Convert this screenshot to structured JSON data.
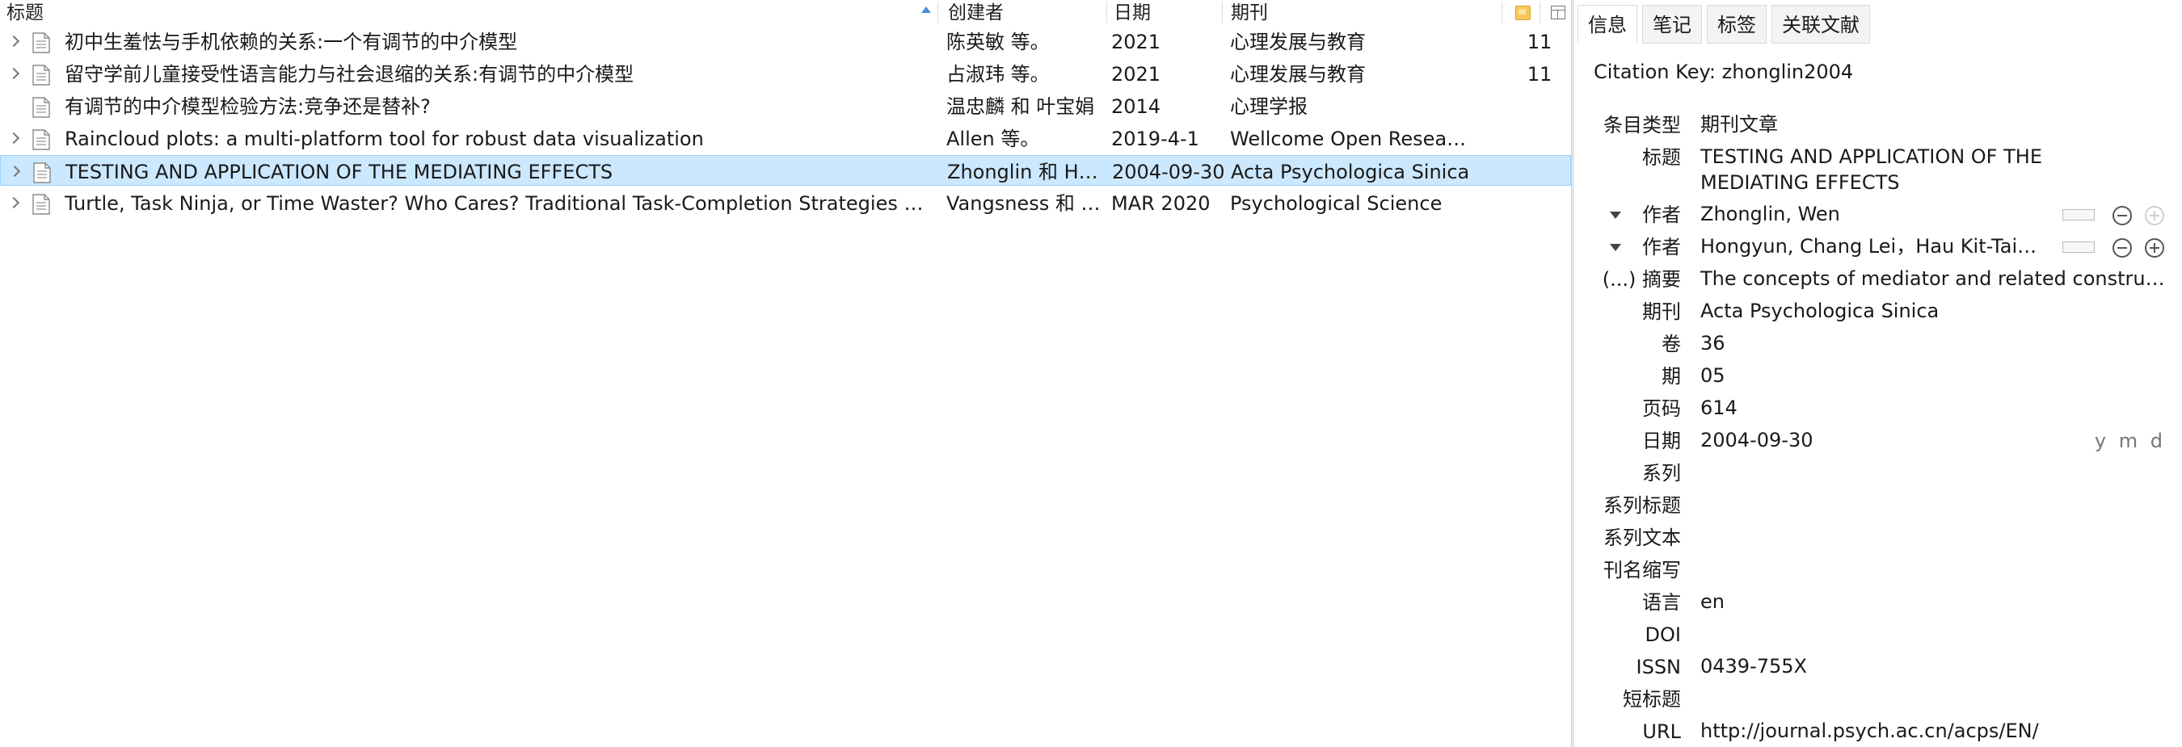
{
  "columns": {
    "title": "标题",
    "creator": "创建者",
    "date": "日期",
    "publication": "期刊"
  },
  "items": [
    {
      "title": "初中生羞怯与手机依赖的关系:一个有调节的中介模型",
      "creator": "陈英敏 等。",
      "date": "2021",
      "publication": "心理发展与教育",
      "extra": "11"
    },
    {
      "title": "留守学前儿童接受性语言能力与社会退缩的关系:有调节的中介模型",
      "creator": "占淑玮 等。",
      "date": "2021",
      "publication": "心理发展与教育",
      "extra": "11"
    },
    {
      "title": "有调节的中介模型检验方法:竞争还是替补?",
      "creator": "温忠麟 和 叶宝娟",
      "date": "2014",
      "publication": "心理学报",
      "extra": ""
    },
    {
      "title": "Raincloud plots: a multi-platform tool for robust data visualization",
      "creator": "Allen 等。",
      "date": "2019-4-1",
      "publication": "Wellcome Open Research",
      "extra": ""
    },
    {
      "title": "TESTING AND APPLICATION OF THE MEDIATING EFFECTS",
      "creator": "Zhonglin 和 Hongyun",
      "date": "2004-09-30",
      "publication": "Acta Psychologica Sinica",
      "extra": ""
    },
    {
      "title": "Turtle, Task Ninja, or Time Waster? Who Cares? Traditional Task-Completion Strategies Are Overrated",
      "creator": "Vangsness 和 Young",
      "date": "MAR 2020",
      "publication": "Psychological Science",
      "extra": ""
    }
  ],
  "pane": {
    "tabs": [
      "信息",
      "笔记",
      "标签",
      "关联文献"
    ],
    "citation_key": "Citation Key: zhonglin2004",
    "fields": {
      "item_type": {
        "label": "条目类型",
        "value": "期刊文章"
      },
      "title": {
        "label": "标题",
        "value": "TESTING AND APPLICATION OF THE MEDIATING EFFECTS"
      },
      "author1": {
        "label": "作者",
        "value": "Zhonglin, Wen"
      },
      "author2": {
        "label": "作者",
        "value": "Hongyun, Chang Lei，Hau Kit-Tai，Liu"
      },
      "abstract": {
        "label": "(...) 摘要",
        "value": "The concepts of mediator and related constructs are introduced"
      },
      "publication": {
        "label": "期刊",
        "value": "Acta Psychologica Sinica"
      },
      "volume": {
        "label": "卷",
        "value": "36"
      },
      "issue": {
        "label": "期",
        "value": "05"
      },
      "pages": {
        "label": "页码",
        "value": "614"
      },
      "date": {
        "label": "日期",
        "value": "2004-09-30",
        "ymd": "y m d"
      },
      "series": {
        "label": "系列",
        "value": ""
      },
      "series_title": {
        "label": "系列标题",
        "value": ""
      },
      "series_text": {
        "label": "系列文本",
        "value": ""
      },
      "journal_abbr": {
        "label": "刊名缩写",
        "value": ""
      },
      "language": {
        "label": "语言",
        "value": "en"
      },
      "doi": {
        "label": "DOI",
        "value": ""
      },
      "issn": {
        "label": "ISSN",
        "value": "0439-755X"
      },
      "short_title": {
        "label": "短标题",
        "value": ""
      },
      "url": {
        "label": "URL",
        "value": "http://journal.psych.ac.cn/acps/EN/"
      }
    }
  },
  "colors": {
    "selection_bg": "#cce8ff",
    "selection_border": "#99d1ff",
    "sort_arrow": "#4a90d9"
  }
}
